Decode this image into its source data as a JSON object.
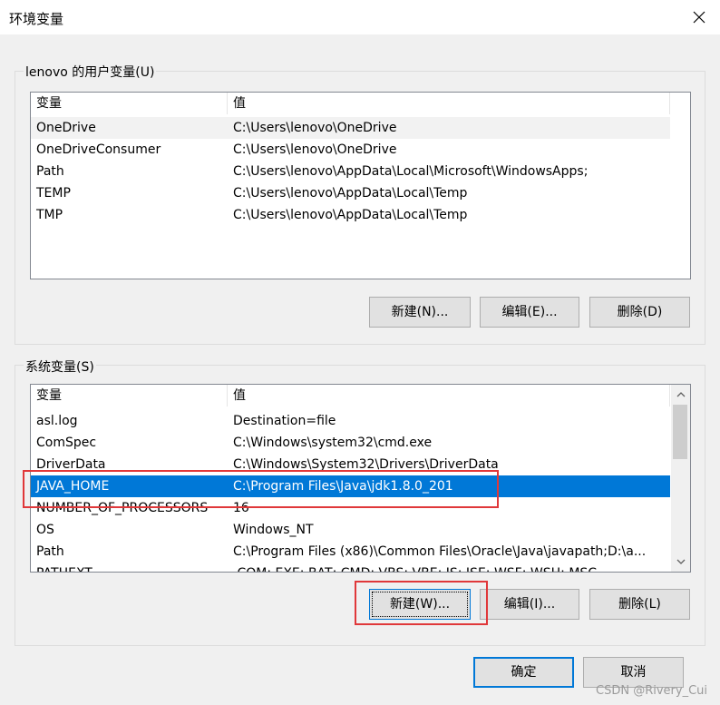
{
  "window": {
    "title": "环境变量",
    "close_icon": "close-icon"
  },
  "user_vars": {
    "group_label": "lenovo 的用户变量(U)",
    "columns": [
      "变量",
      "值"
    ],
    "rows": [
      {
        "name": "OneDrive",
        "value": "C:\\Users\\lenovo\\OneDrive"
      },
      {
        "name": "OneDriveConsumer",
        "value": "C:\\Users\\lenovo\\OneDrive"
      },
      {
        "name": "Path",
        "value": "C:\\Users\\lenovo\\AppData\\Local\\Microsoft\\WindowsApps;"
      },
      {
        "name": "TEMP",
        "value": "C:\\Users\\lenovo\\AppData\\Local\\Temp"
      },
      {
        "name": "TMP",
        "value": "C:\\Users\\lenovo\\AppData\\Local\\Temp"
      }
    ],
    "buttons": {
      "new": "新建(N)...",
      "edit": "编辑(E)...",
      "delete": "删除(D)"
    }
  },
  "system_vars": {
    "group_label": "系统变量(S)",
    "columns": [
      "变量",
      "值"
    ],
    "rows": [
      {
        "name": "asl.log",
        "value": "Destination=file"
      },
      {
        "name": "ComSpec",
        "value": "C:\\Windows\\system32\\cmd.exe"
      },
      {
        "name": "DriverData",
        "value": "C:\\Windows\\System32\\Drivers\\DriverData"
      },
      {
        "name": "JAVA_HOME",
        "value": "C:\\Program Files\\Java\\jdk1.8.0_201"
      },
      {
        "name": "NUMBER_OF_PROCESSORS",
        "value": "16"
      },
      {
        "name": "OS",
        "value": "Windows_NT"
      },
      {
        "name": "Path",
        "value": "C:\\Program Files (x86)\\Common Files\\Oracle\\Java\\javapath;D:\\a..."
      },
      {
        "name": "PATHEXT",
        "value": ".COM;.EXE;.BAT;.CMD;.VBS;.VBE;.JS;.JSE;.WSF;.WSH;.MSC"
      }
    ],
    "selected_row": "JAVA_HOME",
    "buttons": {
      "new": "新建(W)...",
      "edit": "编辑(I)...",
      "delete": "删除(L)"
    }
  },
  "footer": {
    "ok": "确定",
    "cancel": "取消"
  },
  "watermark": "CSDN @Rivery_Cui",
  "colors": {
    "selection": "#0078d7",
    "highlight_box": "#e0383a"
  }
}
